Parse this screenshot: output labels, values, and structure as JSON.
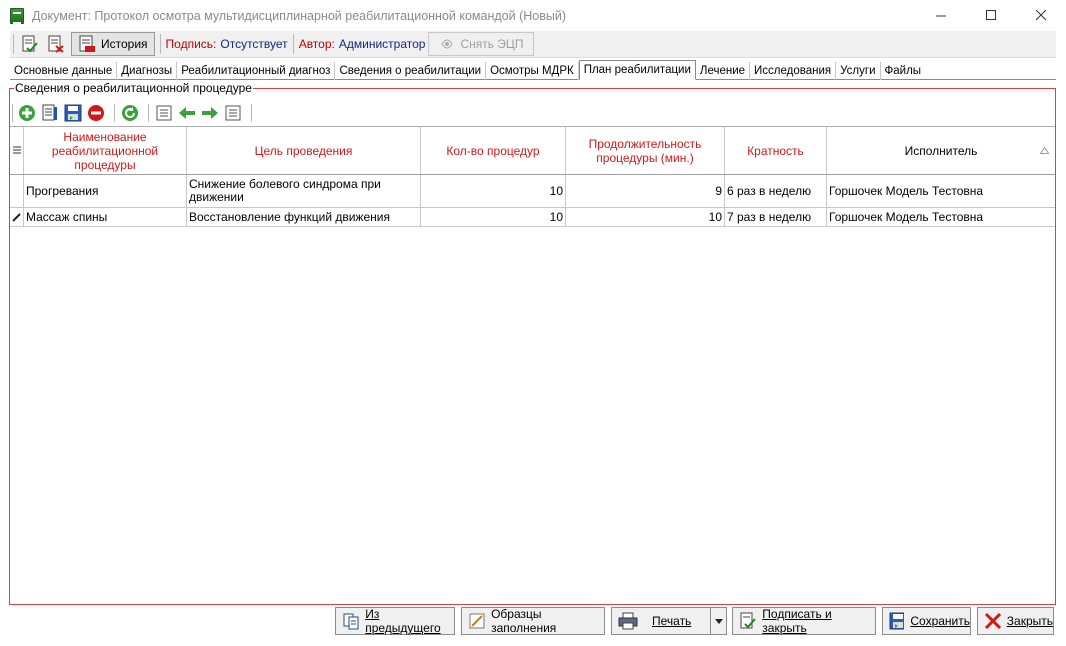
{
  "window": {
    "title": "Документ: Протокол осмотра мультидисциплинарной реабилитационной командой (Новый)"
  },
  "toolbar": {
    "history_label": "История",
    "signature_label": "Подпись:",
    "signature_value": "Отсутствует",
    "author_label": "Автор:",
    "author_value": "Администратор",
    "remove_sign_label": "Снять ЭЦП"
  },
  "tabs": [
    {
      "label": "Основные данные"
    },
    {
      "label": "Диагнозы"
    },
    {
      "label": "Реабилитационный диагноз"
    },
    {
      "label": "Сведения о реабилитации"
    },
    {
      "label": "Осмотры МДРК"
    },
    {
      "label": "План реабилитации",
      "active": true
    },
    {
      "label": "Лечение"
    },
    {
      "label": "Исследования"
    },
    {
      "label": "Услуги"
    },
    {
      "label": "Файлы"
    }
  ],
  "group": {
    "legend": "Сведения о реабилитационной процедуре"
  },
  "table": {
    "columns": [
      {
        "label": "Наименование реабилитационной процедуры"
      },
      {
        "label": "Цель проведения"
      },
      {
        "label": "Кол-во процедур"
      },
      {
        "label": "Продолжительность процедуры (мин.)"
      },
      {
        "label": "Кратность"
      },
      {
        "label": "Исполнитель"
      }
    ],
    "rows": [
      {
        "name": "Прогревания",
        "goal": "Снижение болевого синдрома при движении",
        "count": "10",
        "duration": "9",
        "frequency": "6 раз в неделю",
        "performer": "Горшочек Модель Тестовна"
      },
      {
        "name": "Массаж спины",
        "goal": "Восстановление функций движения",
        "count": "10",
        "duration": "10",
        "frequency": "7 раз в неделю",
        "performer": "Горшочек Модель Тестовна"
      }
    ]
  },
  "footer": {
    "from_previous": "Из предыдущего",
    "samples": "Образцы заполнения",
    "print": "Печать",
    "sign_close": "Подписать и закрыть",
    "save": "Сохранить",
    "close": "Закрыть"
  },
  "colors": {
    "accent_red": "#d01818",
    "group_border": "#d94040",
    "green_icon": "#3ca03c"
  }
}
